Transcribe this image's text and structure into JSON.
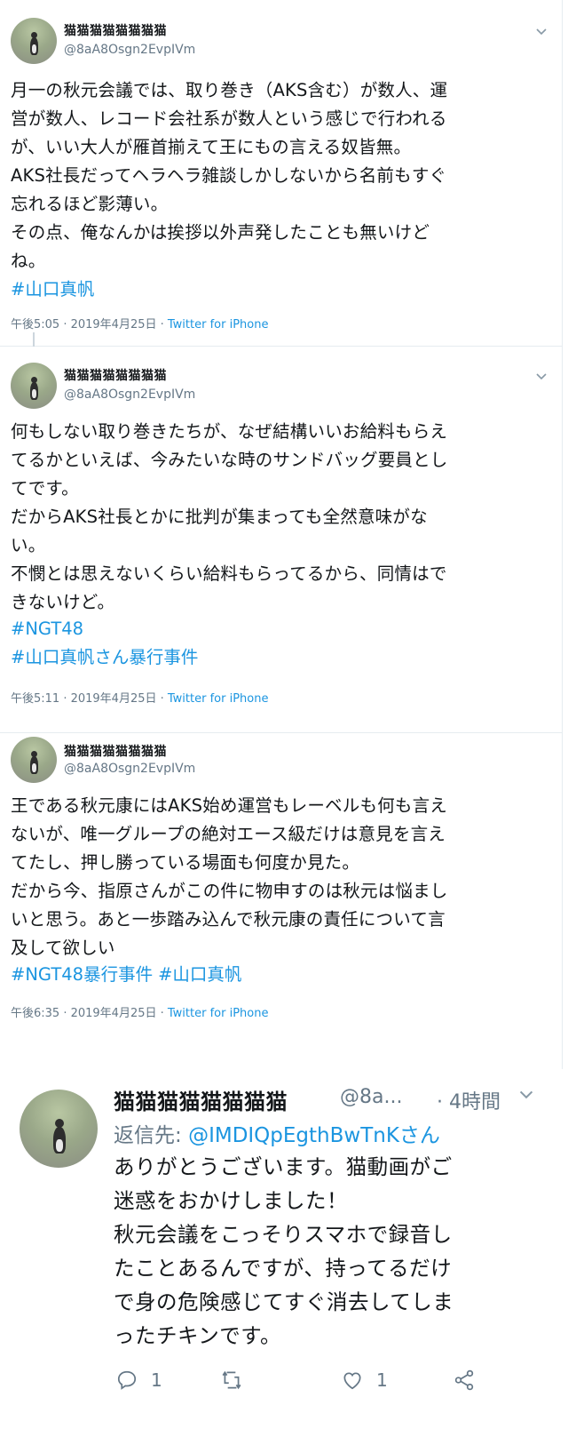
{
  "tweets": [
    {
      "name": "猫猫猫猫猫猫猫猫",
      "handle": "@8aA8Osgn2EvpIVm",
      "body": "月一の秋元会議では、取り巻き（AKS含む）が数人、運\n営が数人、レコード会社系が数人という感じで行われる\nが、いい大人が雁首揃えて王にもの言える奴皆無。\nAKS社長だってヘラヘラ雑談しかしないから名前もすぐ\n忘れるほど影薄い。\nその点、俺なんかは挨拶以外声発したことも無いけど\nね。",
      "hashtags": [
        "#山口真帆"
      ],
      "time": "午後5:05 · 2019年4月25日 · ",
      "source": "Twitter for iPhone"
    },
    {
      "name": "猫猫猫猫猫猫猫猫",
      "handle": "@8aA8Osgn2EvpIVm",
      "body": "何もしない取り巻きたちが、なぜ結構いいお給料もらえ\nてるかといえば、今みたいな時のサンドバッグ要員とし\nてです。\nだからAKS社長とかに批判が集まっても全然意味がな\nい。\n不憫とは思えないくらい給料もらってるから、同情はで\nきないけど。",
      "hashtags": [
        "#NGT48",
        "#山口真帆さん暴行事件"
      ],
      "time": "午後5:11 · 2019年4月25日 · ",
      "source": "Twitter for iPhone"
    },
    {
      "name": "猫猫猫猫猫猫猫猫",
      "handle": "@8aA8Osgn2EvpIVm",
      "body": "王である秋元康にはAKS始め運営もレーベルも何も言え\nないが、唯一グループの絶対エース級だけは意見を言え\nてたし、押し勝っている場面も何度か見た。\nだから今、指原さんがこの件に物申すのは秋元は悩まし\nいと思う。あと一歩踏み込んで秋元康の責任について言\n及して欲しい",
      "hashtags": [
        "#NGT48暴行事件",
        "#山口真帆"
      ],
      "time": "午後6:35 · 2019年4月25日 · ",
      "source": "Twitter for iPhone"
    }
  ],
  "reply": {
    "name": "猫猫猫猫猫猫猫猫",
    "handle": "@8a...",
    "time": "· 4時間",
    "to_prefix": "返信先: ",
    "to_mention": "@IMDIQpEgthBwTnKさん",
    "body": "ありがとうございます。猫動画がご\n迷惑をおかけしました！\n秋元会議をこっそりスマホで録音し\nたことあるんですが、持ってるだけ\nで身の危険感じてすぐ消去してしま\nったチキンです。",
    "reply_count": "1",
    "like_count": "1"
  },
  "icons": {
    "chevron": "chevron-down-icon",
    "reply": "reply-bubble-icon",
    "retweet": "retweet-icon",
    "like": "heart-icon",
    "share": "share-icon"
  },
  "colors": {
    "link": "#1b95e0",
    "muted": "#657786"
  }
}
